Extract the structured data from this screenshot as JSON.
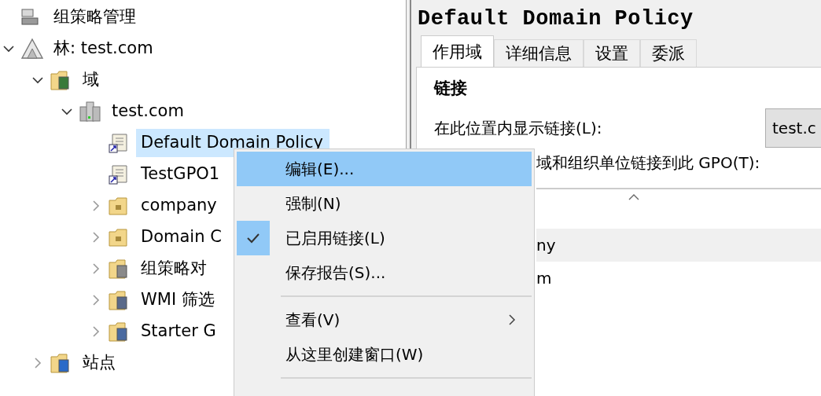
{
  "tree": [
    {
      "label": "组策略管理",
      "kind": "console",
      "selected": false,
      "children": [
        {
          "label": "林: test.com",
          "kind": "forest",
          "selected": false,
          "expanded": true,
          "children": [
            {
              "label": "域",
              "kind": "domains",
              "selected": false,
              "expanded": true,
              "children": [
                {
                  "label": "test.com",
                  "kind": "domain",
                  "selected": false,
                  "expanded": true,
                  "children": [
                    {
                      "label": "Default Domain Policy",
                      "kind": "gpo-link",
                      "selected": true
                    },
                    {
                      "label": "TestGPO1",
                      "kind": "gpo-link",
                      "selected": false
                    },
                    {
                      "label": "company",
                      "kind": "ou",
                      "selected": false,
                      "expanded": false
                    },
                    {
                      "label": "Domain C",
                      "kind": "ou",
                      "selected": false,
                      "expanded": false
                    },
                    {
                      "label": "组策略对",
                      "kind": "gpo-folder",
                      "selected": false,
                      "expanded": false
                    },
                    {
                      "label": "WMI 筛选",
                      "kind": "filter-folder",
                      "selected": false,
                      "expanded": false
                    },
                    {
                      "label": "Starter G",
                      "kind": "starter-folder",
                      "selected": false,
                      "expanded": false
                    }
                  ]
                }
              ]
            },
            {
              "label": "站点",
              "kind": "sites",
              "selected": false,
              "expanded": false
            }
          ]
        }
      ]
    }
  ],
  "details": {
    "title": "Default Domain Policy",
    "tabs": [
      {
        "label": "作用域",
        "selected": true
      },
      {
        "label": "详细信息",
        "selected": false
      },
      {
        "label": "设置",
        "selected": false
      },
      {
        "label": "委派",
        "selected": false
      }
    ],
    "section": "链接",
    "location_label": "在此位置内显示链接(L):",
    "location_value": "test.c",
    "linked_label": "域和组织单位链接到此 GPO(T):",
    "rows": [
      {
        "cell": "ny",
        "selected": true
      },
      {
        "cell": "m",
        "selected": false
      }
    ]
  },
  "context_menu": [
    {
      "kind": "item",
      "label": "编辑(E)...",
      "selected": true,
      "checked": false,
      "submenu": false
    },
    {
      "kind": "item",
      "label": "强制(N)",
      "selected": false,
      "checked": false,
      "submenu": false
    },
    {
      "kind": "item",
      "label": "已启用链接(L)",
      "selected": false,
      "checked": true,
      "submenu": false
    },
    {
      "kind": "item",
      "label": "保存报告(S)...",
      "selected": false,
      "checked": false,
      "submenu": false
    },
    {
      "kind": "separator"
    },
    {
      "kind": "item",
      "label": "查看(V)",
      "selected": false,
      "checked": false,
      "submenu": true
    },
    {
      "kind": "item",
      "label": "从这里创建窗口(W)",
      "selected": false,
      "checked": false,
      "submenu": false
    },
    {
      "kind": "separator"
    }
  ]
}
